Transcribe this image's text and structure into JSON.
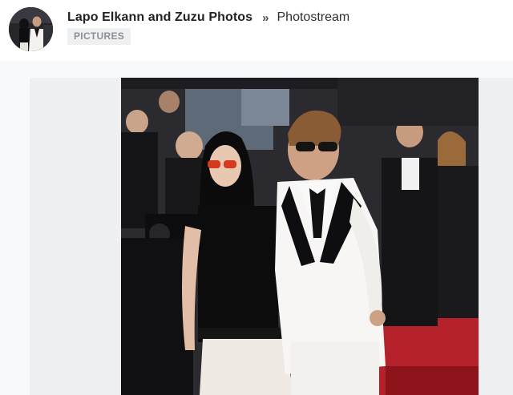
{
  "header": {
    "avatar_icon": "album-avatar",
    "album_title": "Lapo Elkann and Zuzu Photos",
    "separator": "»",
    "current_section": "Photostream",
    "category_badge": "PICTURES"
  },
  "photo": {
    "icon": "photo-image",
    "background": "#eeeff1"
  },
  "colors": {
    "title_text": "#1f2124",
    "badge_bg": "#eef0f2",
    "badge_text": "#8b9097",
    "band_bg": "#f8f9fa"
  }
}
